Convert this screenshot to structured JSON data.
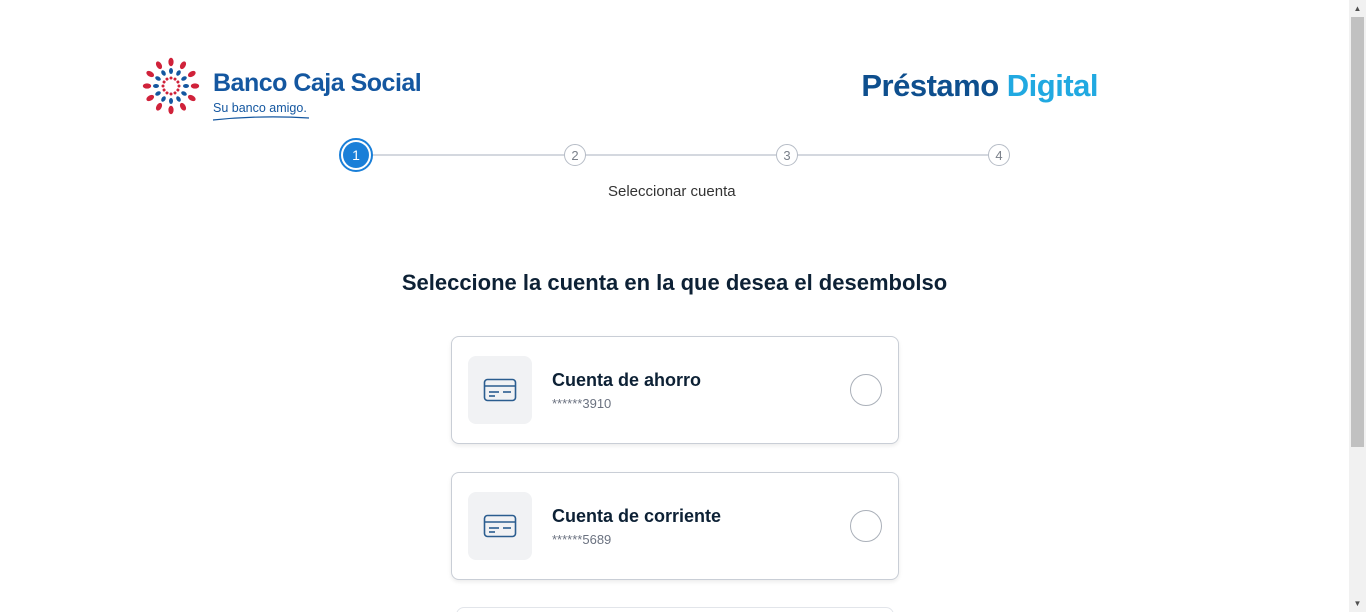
{
  "brand": {
    "name": "Banco Caja Social",
    "tagline": "Su banco amigo.",
    "colors": {
      "primary": "#1457a0",
      "accent": "#d0223a"
    }
  },
  "product": {
    "title_part1": "Préstamo",
    "title_part2": "Digital",
    "colors": {
      "part1": "#0e4f8e",
      "part2": "#21a9e1"
    }
  },
  "stepper": {
    "steps": [
      "1",
      "2",
      "3",
      "4"
    ],
    "active_step": 1,
    "active_label": "Seleccionar cuenta"
  },
  "main": {
    "heading": "Seleccione la cuenta en la que desea el desembolso",
    "accounts": [
      {
        "name": "Cuenta de ahorro",
        "number": "******3910",
        "icon": "credit-card-icon",
        "selected": false
      },
      {
        "name": "Cuenta de corriente",
        "number": "******5689",
        "icon": "credit-card-icon",
        "selected": false
      }
    ]
  }
}
